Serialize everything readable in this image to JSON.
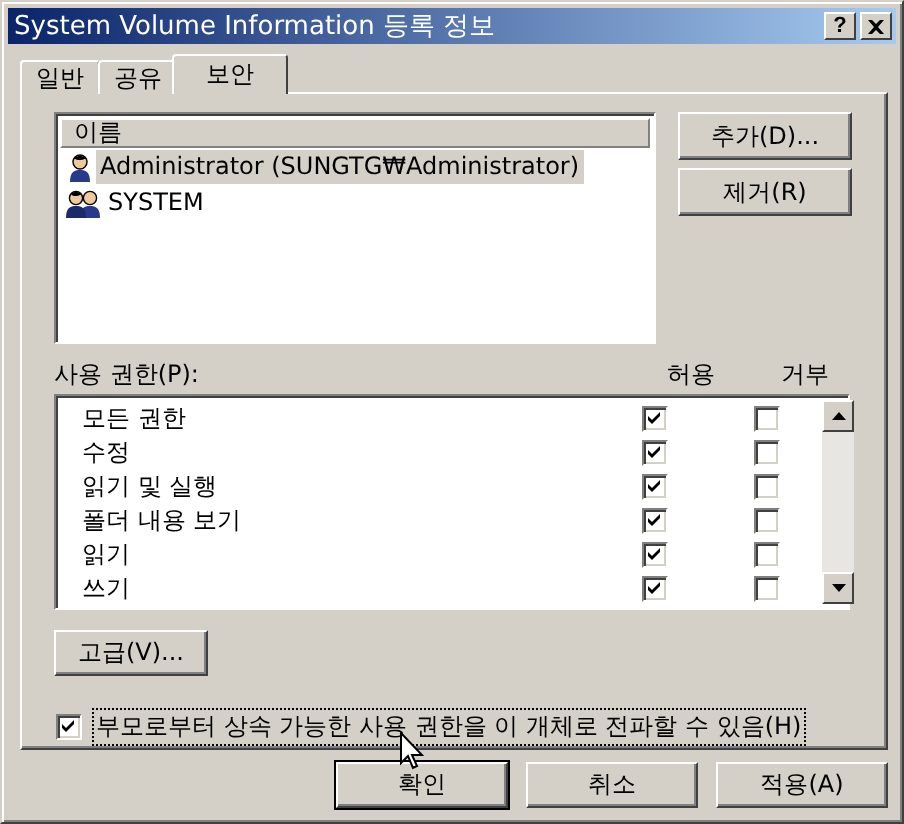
{
  "window": {
    "title": "System Volume Information 등록 정보",
    "help": "?"
  },
  "tabs": [
    {
      "label": "일반",
      "selected": false
    },
    {
      "label": "공유",
      "selected": false
    },
    {
      "label": "보안",
      "selected": true
    }
  ],
  "names": {
    "column": "이름",
    "items": [
      {
        "name": "Administrator (SUNGTG₩Administrator)",
        "kind": "user",
        "selected": true
      },
      {
        "name": "SYSTEM",
        "kind": "group",
        "selected": false
      }
    ]
  },
  "name_buttons": [
    "추가(D)...",
    "제거(R)"
  ],
  "permissions": {
    "label": "사용 권한(P):",
    "columns": [
      "허용",
      "거부"
    ],
    "rows": [
      {
        "name": "모든 권한",
        "allow": true,
        "deny": false
      },
      {
        "name": "수정",
        "allow": true,
        "deny": false
      },
      {
        "name": "읽기 및 실행",
        "allow": true,
        "deny": false
      },
      {
        "name": "폴더 내용 보기",
        "allow": true,
        "deny": false
      },
      {
        "name": "읽기",
        "allow": true,
        "deny": false
      },
      {
        "name": "쓰기",
        "allow": true,
        "deny": false
      }
    ]
  },
  "advanced_button": "고급(V)...",
  "inherit": {
    "label": "부모로부터 상속 가능한 사용 권한을 이 개체로 전파할 수 있음(H)",
    "checked": true
  },
  "buttons": [
    {
      "label": "확인",
      "default": true
    },
    {
      "label": "취소",
      "default": false
    },
    {
      "label": "적용(A)",
      "default": false
    }
  ]
}
